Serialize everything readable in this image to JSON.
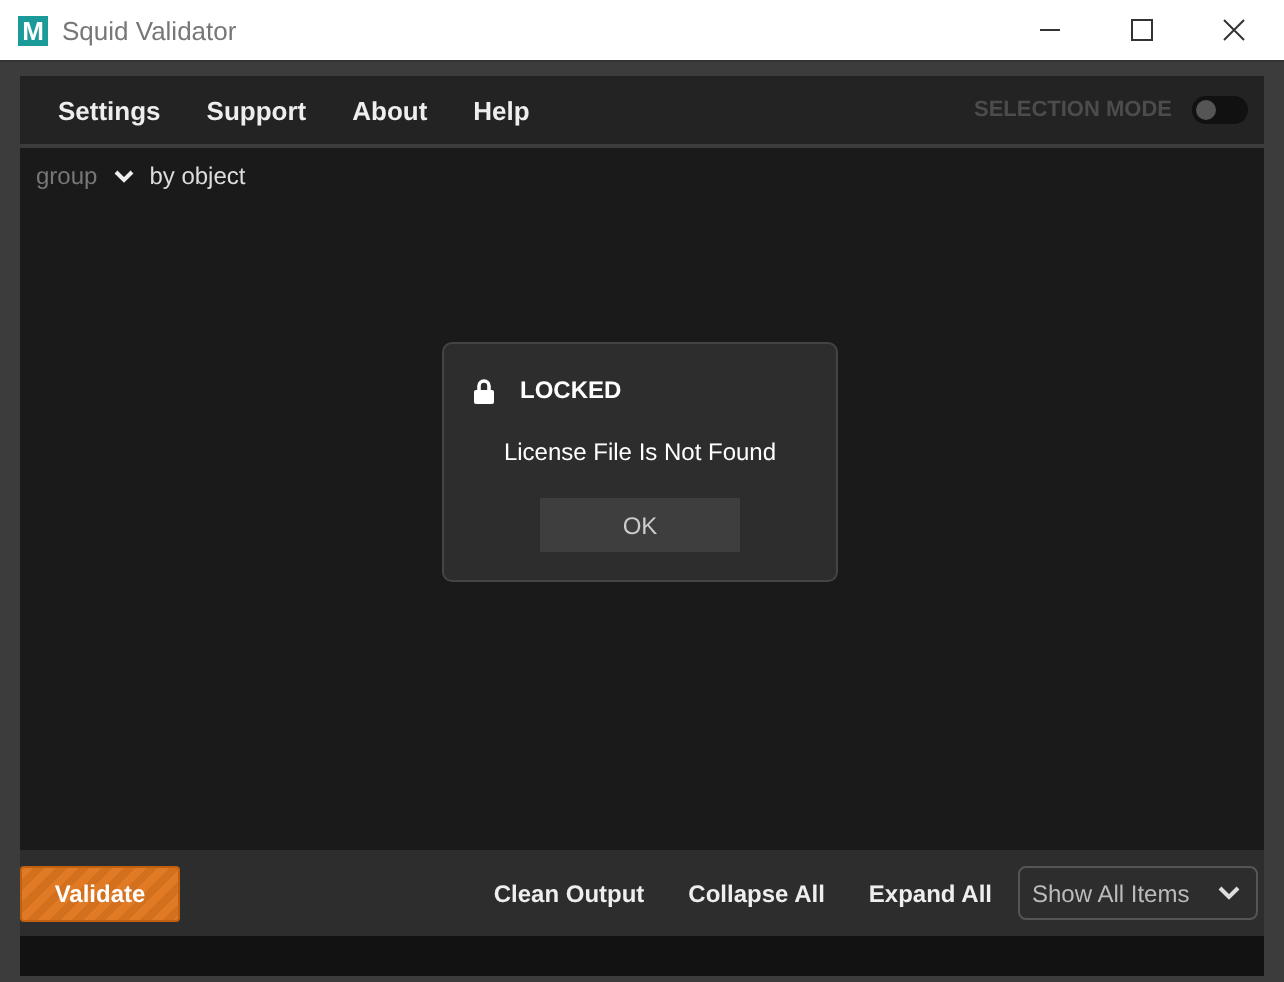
{
  "window": {
    "title": "Squid Validator",
    "app_icon": "M"
  },
  "menu": [
    "Settings",
    "Support",
    "About",
    "Help"
  ],
  "selection_mode": {
    "label": "SELECTION MODE",
    "on": false
  },
  "group": {
    "label": "group",
    "value": "by object"
  },
  "dialog": {
    "title": "LOCKED",
    "message": "License File Is Not Found",
    "button": "OK"
  },
  "bottom": {
    "validate": "Validate",
    "actions": [
      "Clean Output",
      "Collapse All",
      "Expand All"
    ],
    "filter": "Show All Items"
  }
}
